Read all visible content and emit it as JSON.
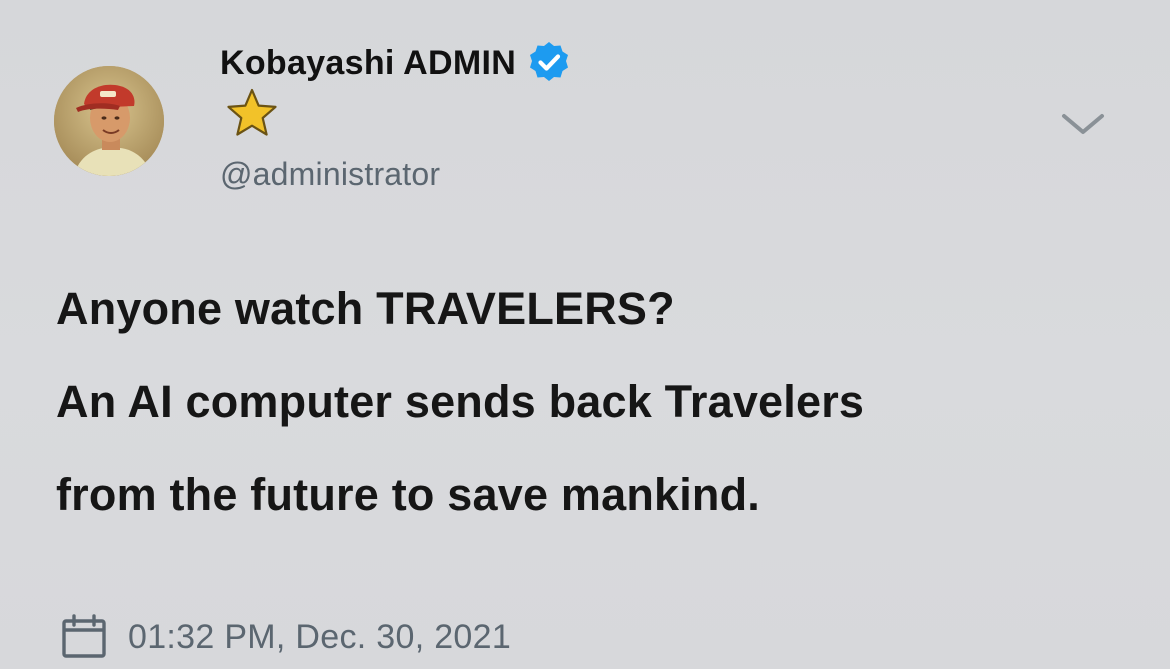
{
  "author": {
    "display_name": "Kobayashi ADMIN",
    "handle": "@administrator",
    "verified": true,
    "badge": "star-icon",
    "avatar": "profile-photo"
  },
  "tweet": {
    "lines": [
      "Anyone watch TRAVELERS?",
      "An AI computer sends back Travelers",
      "from the future to save mankind."
    ],
    "timestamp": "01:32 PM, Dec. 30, 2021"
  },
  "icons": {
    "verified": "verified-badge-icon",
    "star": "star-icon",
    "menu": "chevron-down-icon",
    "calendar": "calendar-icon"
  },
  "colors": {
    "background": "#d8d9dc",
    "verified_blue": "#1d9bf0",
    "star_gold": "#f2c229",
    "secondary_text": "#5b6670",
    "primary_text": "#161616"
  }
}
